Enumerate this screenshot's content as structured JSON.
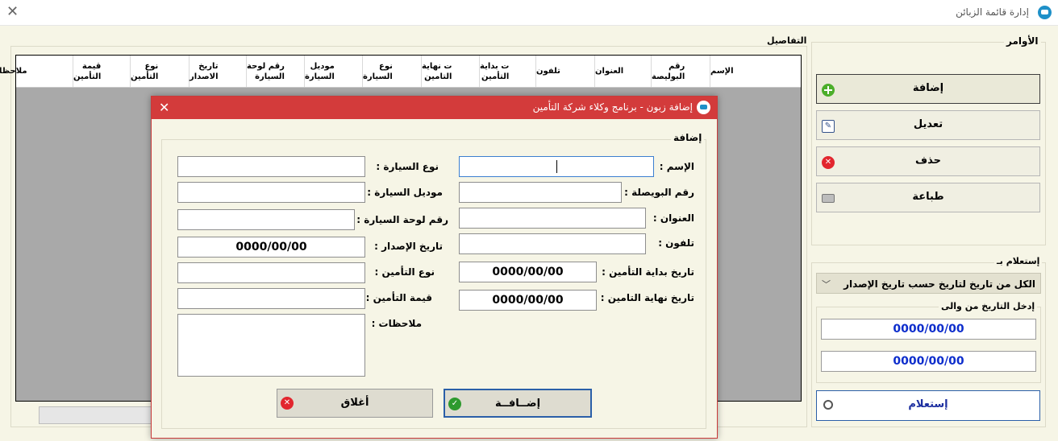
{
  "window": {
    "title": "إدارة قائمة الزبائن"
  },
  "details": {
    "label": "التفاصيل",
    "columns": [
      {
        "line1": "الإسم",
        "line2": ""
      },
      {
        "line1": "رقم",
        "line2": "البوليصة"
      },
      {
        "line1": "العنوان",
        "line2": ""
      },
      {
        "line1": "تلفون",
        "line2": ""
      },
      {
        "line1": "ت بداية",
        "line2": "التأمين"
      },
      {
        "line1": "ت نهاية",
        "line2": "التامين"
      },
      {
        "line1": "نوع",
        "line2": "السيارة"
      },
      {
        "line1": "موديل",
        "line2": "السيارة"
      },
      {
        "line1": "رقم لوحة",
        "line2": "السيارة"
      },
      {
        "line1": "تاريخ",
        "line2": "الاصدار"
      },
      {
        "line1": "نوع",
        "line2": "التأمين"
      },
      {
        "line1": "قيمة",
        "line2": "التأمين"
      },
      {
        "line1": "ملاحظات",
        "line2": ""
      }
    ]
  },
  "commands": {
    "label": "الأوامر",
    "add": "إضافة",
    "edit": "تعديل",
    "delete": "حذف",
    "print": "طباعة"
  },
  "query": {
    "label": "إستعلام بـ",
    "select_value": "الكل من تاريخ لتاريخ حسب تاريخ الإصدار",
    "date_range_label": "إدخل التاريخ من والى",
    "date_from": "0000/00/00",
    "date_to": "0000/00/00",
    "button": "إستعلام"
  },
  "dialog": {
    "title": "إضافة زبون - برنامج وكلاء شركة التأمين",
    "group_label": "إضافة",
    "labels": {
      "name": "الإسم :",
      "policy": "رقم البويصلة :",
      "address": "العنوان :",
      "phone": "تلفون :",
      "start_date": "تاريخ بداية التأمين :",
      "end_date": "تاريخ نهاية التامين :",
      "car_type": "نوع  السيارة :",
      "car_model": "موديل السيارة :",
      "plate": "رقم لوحة السيارة :",
      "issue_date": "تاريخ الإصدار :",
      "ins_type": "نوع التأمين :",
      "ins_value": "قيمة التأمين :",
      "notes": "ملاحظات :"
    },
    "values": {
      "name": "",
      "policy": "",
      "address": "",
      "phone": "",
      "start_date": "0000/00/00",
      "end_date": "0000/00/00",
      "car_type": "",
      "car_model": "",
      "plate": "",
      "issue_date": "0000/00/00",
      "ins_type": "",
      "ins_value": "",
      "notes": ""
    },
    "add_button": "إضــافــة",
    "close_button": "أغلاق"
  },
  "colors": {
    "dialog_title_bar": "#d33b3b",
    "background": "#f6f5e6",
    "date_text_blue": "#0d2dcc"
  }
}
